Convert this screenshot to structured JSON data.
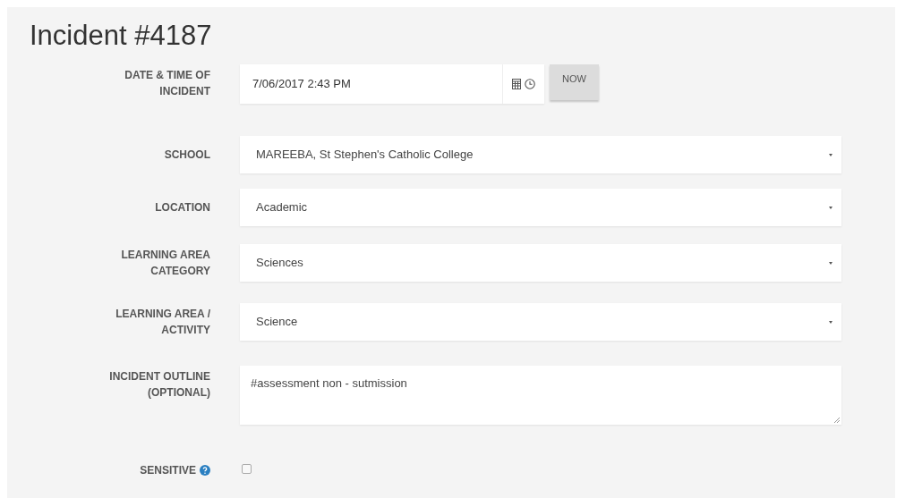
{
  "title": "Incident #4187",
  "fields": [
    {
      "kind": "datetime",
      "label": "DATE & TIME OF INCIDENT",
      "value": "7/06/2017 2:43 PM",
      "button": "NOW"
    },
    {
      "kind": "select",
      "label": "SCHOOL",
      "value": "MAREEBA, St Stephen's Catholic College"
    },
    {
      "kind": "select",
      "label": "LOCATION",
      "value": "Academic"
    },
    {
      "kind": "select",
      "label": "LEARNING AREA CATEGORY",
      "value": "Sciences"
    },
    {
      "kind": "select",
      "label": "LEARNING AREA / ACTIVITY",
      "value": "Science"
    },
    {
      "kind": "textarea",
      "label": "INCIDENT OUTLINE (OPTIONAL)",
      "value": "#assessment non - sutmission"
    },
    {
      "kind": "checkbox",
      "label": "SENSITIVE",
      "checked": false,
      "help": true
    }
  ]
}
